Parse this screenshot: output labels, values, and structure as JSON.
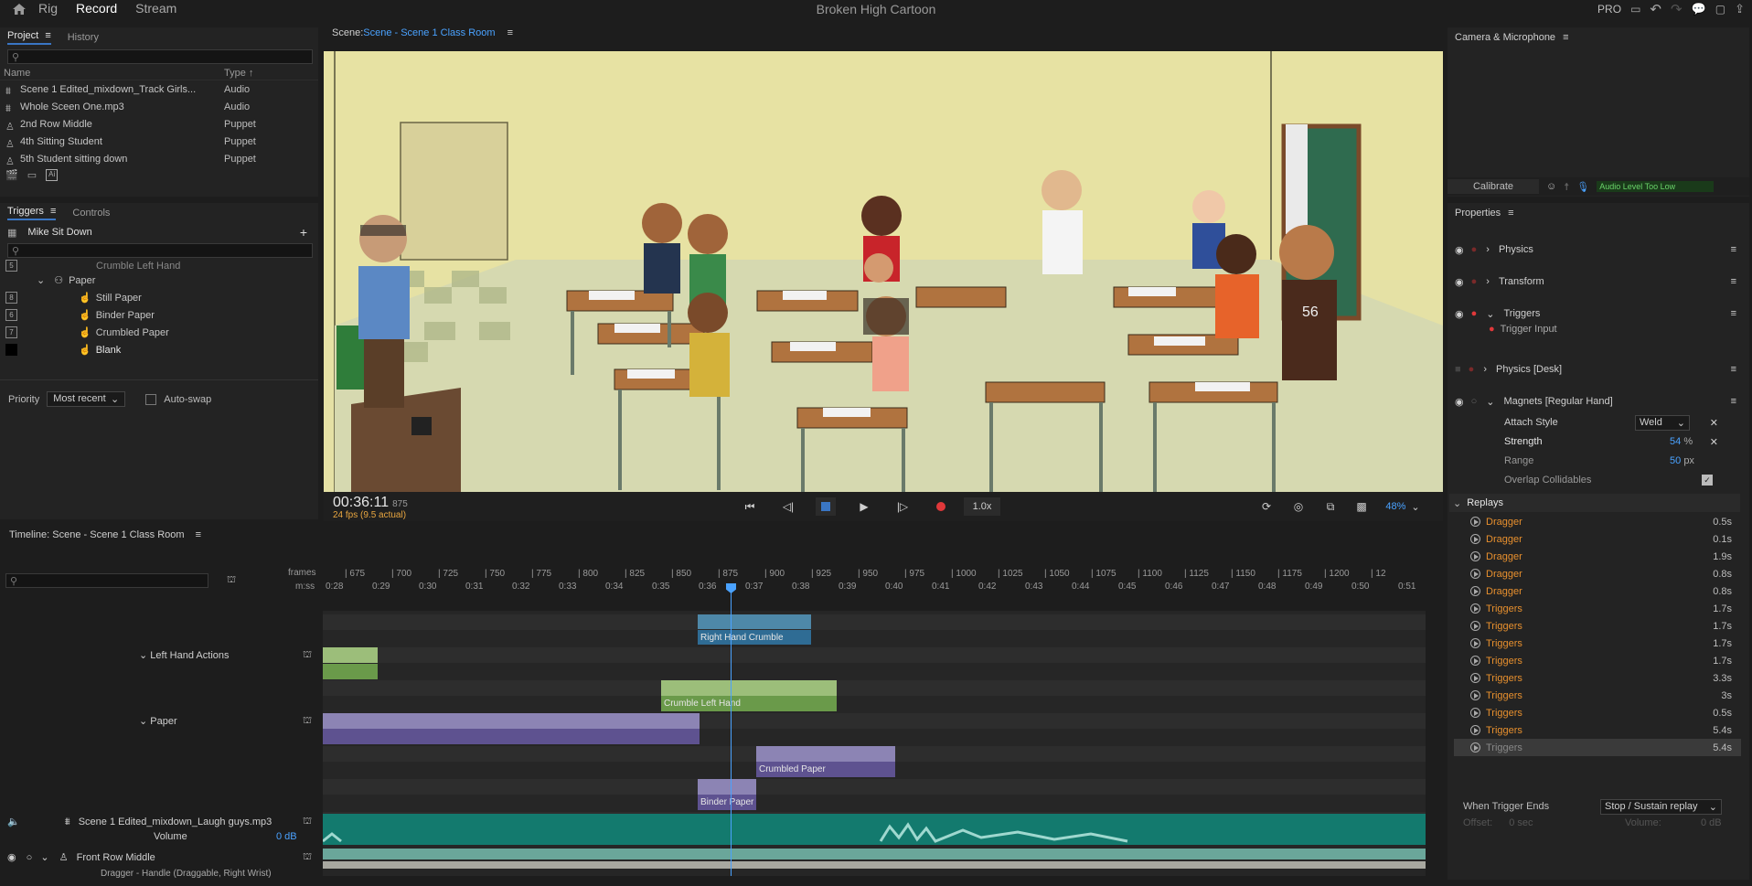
{
  "topbar": {
    "tabs": [
      "Rig",
      "Record",
      "Stream"
    ],
    "active_tab": "Record",
    "app_title": "Broken High Cartoon",
    "pro_label": "PRO"
  },
  "project": {
    "tabs": [
      "Project",
      "History"
    ],
    "col_name": "Name",
    "col_type": "Type",
    "items": [
      {
        "name": "Scene 1 Edited_mixdown_Track Girls...",
        "type": "Audio",
        "icon": "audio-icon"
      },
      {
        "name": "Whole Sceen One.mp3",
        "type": "Audio",
        "icon": "audio-icon"
      },
      {
        "name": "2nd Row Middle",
        "type": "Puppet",
        "icon": "puppet-icon"
      },
      {
        "name": "4th Sitting Student",
        "type": "Puppet",
        "icon": "puppet-icon"
      },
      {
        "name": "5th Student sitting down",
        "type": "Puppet",
        "icon": "puppet-icon"
      }
    ]
  },
  "triggers": {
    "tabs": [
      "Triggers",
      "Controls"
    ],
    "puppet_name": "Mike Sit Down",
    "items": [
      {
        "key": "5",
        "label": "Crumble Left Hand",
        "indent": 2
      },
      {
        "key": "",
        "label": "Paper",
        "indent": 1
      },
      {
        "key": "8",
        "label": "Still Paper",
        "indent": 2
      },
      {
        "key": "6",
        "label": "Binder Paper",
        "indent": 2
      },
      {
        "key": "7",
        "label": "Crumbled Paper",
        "indent": 2
      },
      {
        "key": "",
        "label": "Blank",
        "indent": 2
      }
    ],
    "priority_label": "Priority",
    "priority_value": "Most recent",
    "autoswap_label": "Auto-swap"
  },
  "scene": {
    "label": "Scene:",
    "name": "Scene - Scene 1 Class Room"
  },
  "transport": {
    "time": "00:36:11",
    "frame": "875",
    "fps": "24 fps (9.5 actual)",
    "speed": "1.0x",
    "zoom": "48%"
  },
  "camera": {
    "title": "Camera & Microphone",
    "calibrate": "Calibrate",
    "audio_level": "Audio Level Too Low"
  },
  "properties": {
    "title": "Properties",
    "groups": [
      "Physics",
      "Transform",
      "Triggers",
      "Physics [Desk]",
      "Magnets [Regular Hand]"
    ],
    "trigger_input": "Trigger Input",
    "attach_style_label": "Attach Style",
    "attach_style_value": "Weld",
    "strength_label": "Strength",
    "strength_value": "54",
    "strength_unit": "%",
    "range_label": "Range",
    "range_value": "50",
    "range_unit": "px",
    "overlap_label": "Overlap Collidables"
  },
  "replays": {
    "title": "Replays",
    "items": [
      {
        "name": "Dragger",
        "dur": "0.5s"
      },
      {
        "name": "Dragger",
        "dur": "0.1s"
      },
      {
        "name": "Dragger",
        "dur": "1.9s"
      },
      {
        "name": "Dragger",
        "dur": "0.8s"
      },
      {
        "name": "Dragger",
        "dur": "0.8s"
      },
      {
        "name": "Triggers",
        "dur": "1.7s"
      },
      {
        "name": "Triggers",
        "dur": "1.7s"
      },
      {
        "name": "Triggers",
        "dur": "1.7s"
      },
      {
        "name": "Triggers",
        "dur": "1.7s"
      },
      {
        "name": "Triggers",
        "dur": "3.3s"
      },
      {
        "name": "Triggers",
        "dur": "3s"
      },
      {
        "name": "Triggers",
        "dur": "0.5s"
      },
      {
        "name": "Triggers",
        "dur": "5.4s"
      },
      {
        "name": "Triggers",
        "dur": "5.4s"
      }
    ],
    "when_ends_label": "When Trigger Ends",
    "when_ends_value": "Stop / Sustain replay",
    "offset_label": "Offset:",
    "offset_value": "0 sec",
    "volume_label": "Volume:",
    "volume_value": "0 dB"
  },
  "timeline": {
    "title": "Timeline: Scene - Scene 1 Class Room",
    "frames_label": "frames",
    "mss_label": "m:ss",
    "frame_ticks": [
      "675",
      "700",
      "725",
      "750",
      "775",
      "800",
      "825",
      "850",
      "875",
      "900",
      "925",
      "950",
      "975",
      "1000",
      "1025",
      "1050",
      "1075",
      "1100",
      "1125",
      "1150",
      "1175",
      "1200",
      "12"
    ],
    "time_ticks": [
      "0:28",
      "0:29",
      "0:30",
      "0:31",
      "0:32",
      "0:33",
      "0:34",
      "0:35",
      "0:36",
      "0:37",
      "0:38",
      "0:39",
      "0:40",
      "0:41",
      "0:42",
      "0:43",
      "0:44",
      "0:45",
      "0:46",
      "0:47",
      "0:48",
      "0:49",
      "0:50",
      "0:51"
    ],
    "tracks": {
      "left_hand_actions": "Left Hand Actions",
      "paper": "Paper",
      "audio": "Scene 1 Edited_mixdown_Laugh guys.mp3",
      "volume_label": "Volume",
      "volume_value": "0 dB",
      "front_row": "Front Row Middle",
      "dragger": "Dragger - Handle (Draggable, Right Wrist)"
    },
    "clips": {
      "right_hand_crumble": "Right Hand Crumble",
      "crumble_left_hand": "Crumble Left Hand",
      "crumbled_paper": "Crumbled Paper",
      "binder_paper": "Binder Paper"
    }
  }
}
